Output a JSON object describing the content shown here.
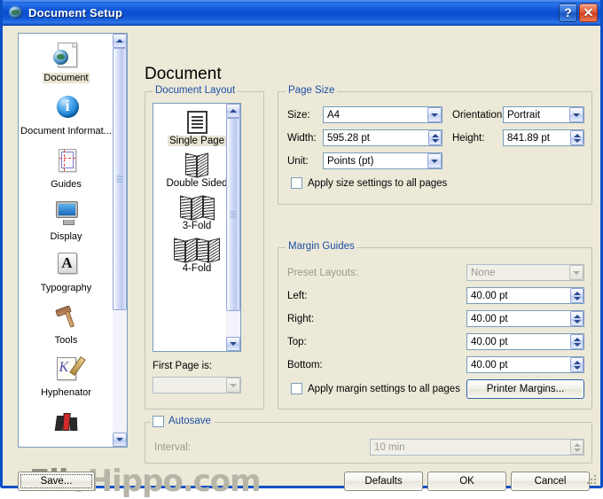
{
  "window": {
    "title": "Document Setup",
    "icon": "globe-icon",
    "help_button": "?",
    "close_button": "✕",
    "accent_title_color": "#0A50D2",
    "dialog_bg_color": "#ECE9D8",
    "group_label_color": "#1C4EA6"
  },
  "sidebar": {
    "items": [
      {
        "label": "Document",
        "icon": "document-globe-icon",
        "selected": true
      },
      {
        "label": "Document Informat...",
        "icon": "info-circle-icon",
        "selected": false
      },
      {
        "label": "Guides",
        "icon": "guides-page-icon",
        "selected": false
      },
      {
        "label": "Display",
        "icon": "monitor-icon",
        "selected": false
      },
      {
        "label": "Typography",
        "icon": "letter-a-icon",
        "selected": false
      },
      {
        "label": "Tools",
        "icon": "hammer-icon",
        "selected": false
      },
      {
        "label": "Hyphenator",
        "icon": "k-pen-icon",
        "selected": false
      },
      {
        "label": "",
        "icon": "books-icon",
        "selected": false
      }
    ]
  },
  "main": {
    "page_title": "Document"
  },
  "document_layout": {
    "group_label": "Document Layout",
    "options": [
      {
        "label": "Single Page",
        "icon": "single-page-icon",
        "selected": true
      },
      {
        "label": "Double Sided",
        "icon": "double-sided-icon",
        "selected": false
      },
      {
        "label": "3-Fold",
        "icon": "three-fold-icon",
        "selected": false
      },
      {
        "label": "4-Fold",
        "icon": "four-fold-icon",
        "selected": false
      }
    ],
    "first_page_label": "First Page is:",
    "first_page_value": "",
    "first_page_disabled": true
  },
  "page_size": {
    "group_label": "Page Size",
    "size_label": "Size:",
    "size_value": "A4",
    "orientation_label": "Orientation:",
    "orientation_value": "Portrait",
    "width_label": "Width:",
    "width_value": "595.28 pt",
    "height_label": "Height:",
    "height_value": "841.89 pt",
    "unit_label": "Unit:",
    "unit_value": "Points (pt)",
    "apply_all_label": "Apply size settings to all pages",
    "apply_all_checked": false
  },
  "margin_guides": {
    "group_label": "Margin Guides",
    "preset_label": "Preset Layouts:",
    "preset_value": "None",
    "preset_disabled": true,
    "left_label": "Left:",
    "left_value": "40.00 pt",
    "right_label": "Right:",
    "right_value": "40.00 pt",
    "top_label": "Top:",
    "top_value": "40.00 pt",
    "bottom_label": "Bottom:",
    "bottom_value": "40.00 pt",
    "apply_all_label": "Apply margin settings to all pages",
    "apply_all_checked": false,
    "printer_margins_button": "Printer Margins..."
  },
  "autosave": {
    "group_label": "Autosave",
    "checked": false,
    "interval_label": "Interval:",
    "interval_value": "10 min",
    "interval_disabled": true
  },
  "footer": {
    "save_button": "Save...",
    "defaults_button": "Defaults",
    "ok_button": "OK",
    "cancel_button": "Cancel"
  },
  "watermark": {
    "text_bold": "File",
    "text_rest": "Hippo.com"
  }
}
